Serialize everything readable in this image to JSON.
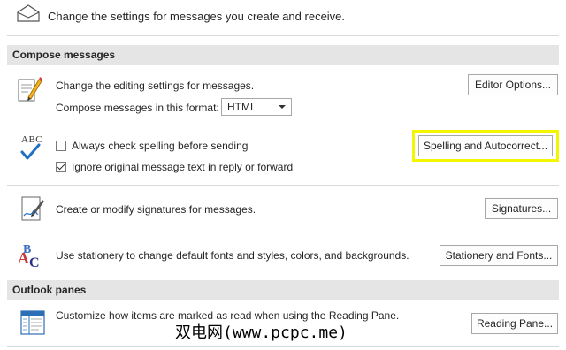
{
  "top": {
    "description": "Change the settings for messages you create and receive."
  },
  "compose": {
    "header": "Compose messages",
    "editing_text": "Change the editing settings for messages.",
    "editor_options_button": "Editor Options...",
    "format_label": "Compose messages in this format:",
    "format_value": "HTML",
    "spelling_abc": "ABC",
    "spell_check_label": "Always check spelling before sending",
    "spell_check_checked": false,
    "ignore_original_label": "Ignore original message text in reply or forward",
    "ignore_original_checked": true,
    "spelling_button": "Spelling and Autocorrect...",
    "signatures_text": "Create or modify signatures for messages.",
    "signatures_button": "Signatures...",
    "stationery_text": "Use stationery to change default fonts and styles, colors, and backgrounds.",
    "stationery_button": "Stationery and Fonts..."
  },
  "panes": {
    "header": "Outlook panes",
    "reading_text": "Customize how items are marked as read when using the Reading Pane.",
    "reading_button": "Reading Pane..."
  },
  "watermark": "双电网(www.pcpc.me)",
  "colors": {
    "highlight": "#f5f500",
    "check_blue": "#1f6fc5",
    "section_bg": "#e5e5e5"
  },
  "icons": {
    "envelope": "envelope-icon",
    "editing": "edit-document-icon",
    "spelling": "abc-check-icon",
    "signature": "signature-icon",
    "stationery": "stationery-abc-icon",
    "reading_pane": "reading-pane-icon"
  }
}
